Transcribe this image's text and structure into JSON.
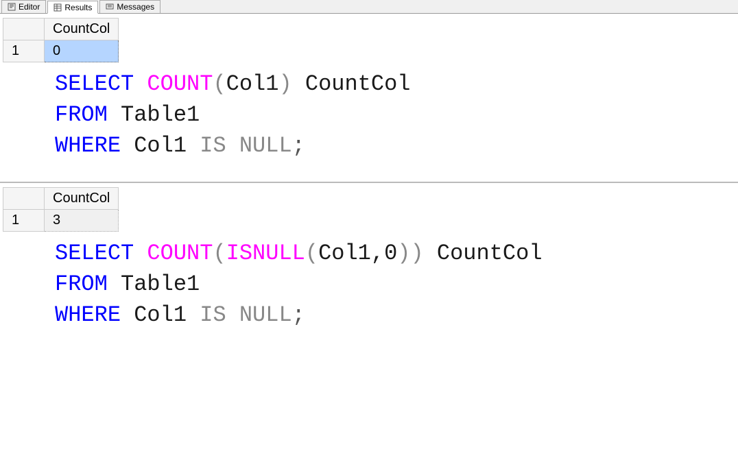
{
  "tabs": {
    "editor": "Editor",
    "results": "Results",
    "messages": "Messages"
  },
  "panel1": {
    "header": "CountCol",
    "rownum": "1",
    "value": "0",
    "sql": {
      "select": "SELECT",
      "count": "COUNT",
      "lp1": "(",
      "col1": "Col1",
      "rp1": ")",
      "alias": " CountCol",
      "from": "FROM",
      "table": " Table1",
      "where": "WHERE",
      "wcol": " Col1 ",
      "is": "IS",
      "sp": " ",
      "null": "NULL",
      "semi": ";"
    }
  },
  "panel2": {
    "header": "CountCol",
    "rownum": "1",
    "value": "3",
    "sql": {
      "select": "SELECT",
      "count": "COUNT",
      "lp1": "(",
      "isnull": "ISNULL",
      "lp2": "(",
      "args": "Col1,0",
      "rp2": ")",
      "rp1": ")",
      "alias": " CountCol",
      "from": "FROM",
      "table": " Table1",
      "where": "WHERE",
      "wcol": " Col1 ",
      "is": "IS",
      "sp": " ",
      "null": "NULL",
      "semi": ";"
    }
  }
}
